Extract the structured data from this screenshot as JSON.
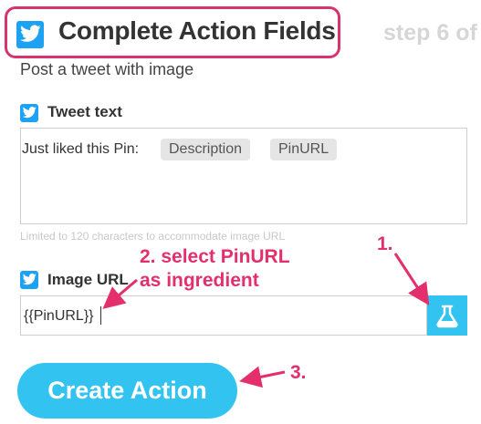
{
  "header": {
    "title": "Complete Action Fields",
    "step": "step 6 of"
  },
  "subtitle": "Post a tweet with image",
  "tweet_text": {
    "label": "Tweet text",
    "prefix": "Just liked this Pin:",
    "ingredients": [
      "Description",
      "PinURL"
    ],
    "hint": "Limited to 120 characters to accommodate image URL"
  },
  "image_url": {
    "label": "Image URL",
    "value": "{{PinURL}}"
  },
  "create_button": "Create Action",
  "annotations": {
    "step1": "1.",
    "step2_line1": "2. select PinURL",
    "step2_line2": "as ingredient",
    "step3": "3."
  },
  "colors": {
    "accent": "#33c3f0",
    "twitter": "#1da1f2",
    "annotation": "#e3306c"
  },
  "icons": {
    "twitter": "twitter-bird-icon",
    "flask": "flask-icon"
  }
}
